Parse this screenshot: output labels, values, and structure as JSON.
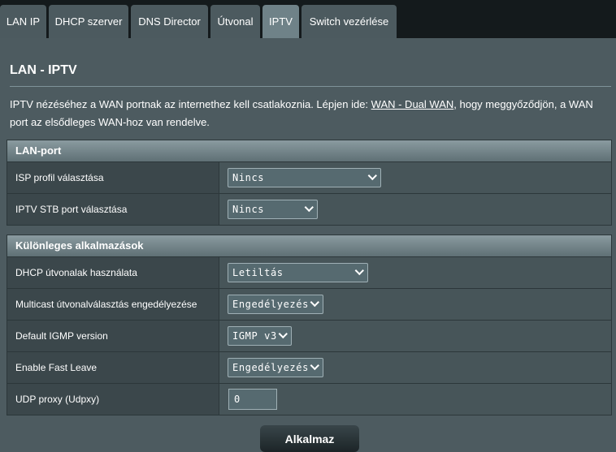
{
  "tabs": [
    {
      "label": "LAN IP"
    },
    {
      "label": "DHCP szerver"
    },
    {
      "label": "DNS Director"
    },
    {
      "label": "Útvonal"
    },
    {
      "label": "IPTV",
      "active": true
    },
    {
      "label": "Switch vezérlése"
    }
  ],
  "page": {
    "title": "LAN - IPTV",
    "intro_before": "IPTV nézéséhez a WAN portnak az internethez kell csatlakoznia. Lépjen ide: ",
    "intro_link": "WAN - Dual WAN",
    "intro_after": ", hogy meggyőződjön, a WAN port az elsődleges WAN-hoz van rendelve."
  },
  "lan_port": {
    "header": "LAN-port",
    "isp_profile": {
      "label": "ISP profil választása",
      "value": "Nincs"
    },
    "stb_port": {
      "label": "IPTV STB port választása",
      "value": "Nincs"
    }
  },
  "special": {
    "header": "Különleges alkalmazások",
    "dhcp_routes": {
      "label": "DHCP útvonalak használata",
      "value": "Letiltás"
    },
    "multicast": {
      "label": "Multicast útvonalválasztás engedélyezése",
      "value": "Engedélyezés"
    },
    "igmp": {
      "label": "Default IGMP version",
      "value": "IGMP v3"
    },
    "fast_leave": {
      "label": "Enable Fast Leave",
      "value": "Engedélyezés"
    },
    "udp_proxy": {
      "label": "UDP proxy (Udpxy)",
      "value": "0"
    }
  },
  "apply_label": "Alkalmaz"
}
